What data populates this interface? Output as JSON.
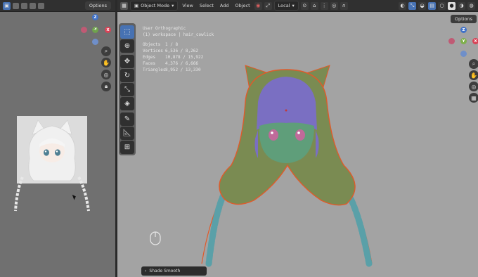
{
  "left_panel": {
    "header_icons": [
      "image-editor-icon",
      "view-icon",
      "mask-icon",
      "grid-icon",
      "tile-icon"
    ],
    "options_label": "Options",
    "gizmo": {
      "z": "Z",
      "y": "-Y",
      "x": "X"
    },
    "nav_icons": [
      "zoom-icon",
      "hand-icon",
      "camera-icon",
      "lock-icon"
    ],
    "reference_image_alt": "Reference character image"
  },
  "viewport": {
    "header": {
      "mode_label": "Object Mode",
      "menus": [
        "View",
        "Select",
        "Add",
        "Object"
      ],
      "transform_orientation": "Local",
      "options_label": "Options"
    },
    "overlay": {
      "view_name": "User Orthographic",
      "collection": "(1) workspace | hair_cowlick",
      "stats": [
        {
          "label": "Objects",
          "value": "1 / 8"
        },
        {
          "label": "Vertices",
          "value": "6,536 / 8,262"
        },
        {
          "label": "Edges",
          "value": "10,878 / 15,922"
        },
        {
          "label": "Faces",
          "value": "4,376 / 6,666"
        },
        {
          "label": "Triangles",
          "value": "8,952 / 13,330"
        }
      ]
    },
    "tools": [
      "select-box-icon",
      "cursor-icon",
      "move-icon",
      "rotate-icon",
      "scale-icon",
      "transform-icon",
      "annotate-icon",
      "measure-icon",
      "add-cube-icon"
    ],
    "gizmo": {
      "z": "Z",
      "y": "Y",
      "x": "X"
    },
    "nav_icons": [
      "zoom-icon",
      "hand-icon",
      "camera-icon",
      "grid-icon"
    ],
    "last_operation": "Shade Smooth",
    "colors": {
      "hair": "#7a8b52",
      "hair_outline": "#e05a2a",
      "face": "#5f9e7a",
      "bangs": "#7a6fc2",
      "braid": "#5aa0a8",
      "viewport_bg": "#a3a3a3"
    }
  }
}
